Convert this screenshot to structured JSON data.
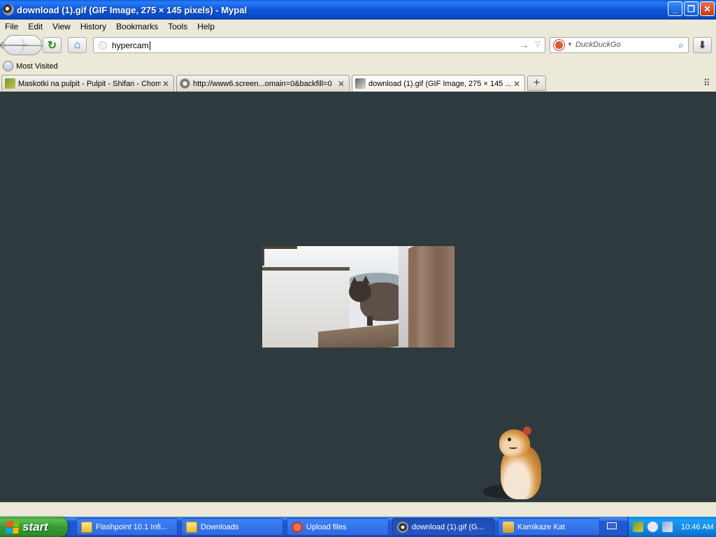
{
  "window": {
    "title": "download (1).gif (GIF Image, 275 × 145 pixels) - Mypal",
    "icon": "mypal-icon",
    "controls": {
      "minimize": "_",
      "restore": "❐",
      "close": "✕"
    }
  },
  "menu": [
    "File",
    "Edit",
    "View",
    "History",
    "Bookmarks",
    "Tools",
    "Help"
  ],
  "navbar": {
    "back": "🡐",
    "forward": "🡒",
    "reload": "↻",
    "home": "⌂",
    "url": "hypercam",
    "go": "→",
    "dropdown": "▽",
    "search_engine": "DuckDuckGo",
    "search_placeholder": "DuckDuckGo",
    "search_icon": "⌕",
    "downloads": "⬇"
  },
  "bookmarks": {
    "most_visited": "Most Visited"
  },
  "tabs": [
    {
      "label": "Maskotki na pulpit - Pulpit - Shifan - Chom...",
      "close": "✕",
      "active": false
    },
    {
      "label": "http://www6.screen...omain=0&backfill=0",
      "close": "✕",
      "active": false
    },
    {
      "label": "download (1).gif (GIF Image, 275 × 145 ...",
      "close": "✕",
      "active": true
    }
  ],
  "tabbar": {
    "new_tab": "+",
    "list_all": "⠿"
  },
  "content": {
    "background": "#2E3A3E",
    "image": "cat-gif",
    "mascot": "hamster-mascot"
  },
  "taskbar": {
    "start": "start",
    "tasks": [
      {
        "label": "Flashpoint 10.1 Infi...",
        "icon": "folder-icon",
        "active": false
      },
      {
        "label": "Downloads",
        "icon": "folder-icon",
        "active": false
      },
      {
        "label": "Upload files",
        "icon": "upload-icon",
        "active": false
      },
      {
        "label": "download (1).gif (G...",
        "icon": "browser-icon",
        "active": true
      },
      {
        "label": "Kamikaze Kat",
        "icon": "kat-icon",
        "active": false
      }
    ],
    "clock": "10:46 AM"
  }
}
